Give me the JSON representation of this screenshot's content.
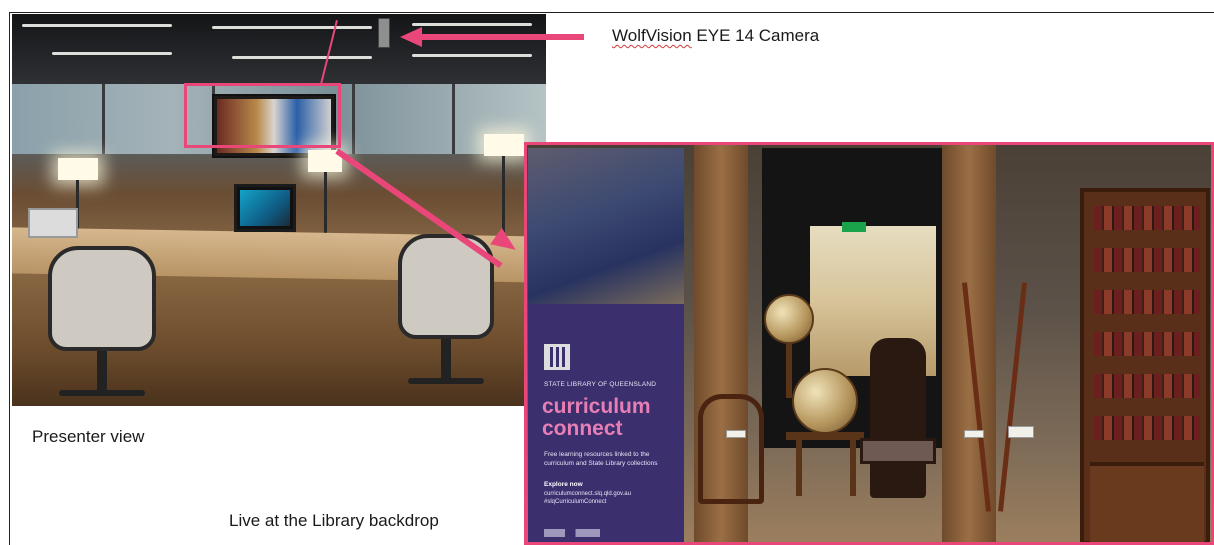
{
  "labels": {
    "camera_brand": "WolfVision",
    "camera_model": " EYE 14 Camera",
    "presenter_view": "Presenter view",
    "library_backdrop": "Live at the Library backdrop"
  },
  "banner": {
    "eyebrow": "STATE LIBRARY OF QUEENSLAND",
    "title_line1": "curriculum",
    "title_line2": "connect",
    "body": "Free learning resources linked to the curriculum and State Library collections",
    "explore_label": "Explore now",
    "url": "curriculumconnect.slq.qld.gov.au #slqCurriculumConnect"
  },
  "colors": {
    "annotation_accent": "#e9477a",
    "banner_purple": "#3b2f6e",
    "banner_title_pink": "#e77fb6"
  }
}
